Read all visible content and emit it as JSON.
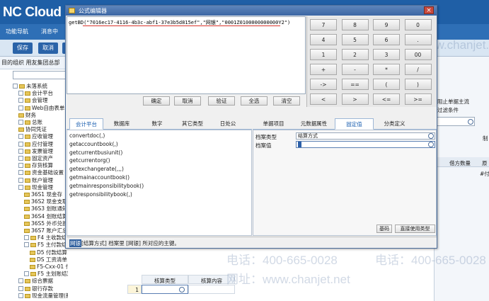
{
  "app": {
    "logo": "NC Cloud",
    "nav_tabs": [
      "功能导航",
      "消息中"
    ],
    "toolbar": [
      "保存",
      "取消",
      "增"
    ],
    "org_label": "目的组织",
    "org_value": "用友集团总部",
    "tree": [
      {
        "label": "未落系统",
        "level": 0,
        "state": "expanded"
      },
      {
        "label": "会计平台",
        "level": 1,
        "state": "collapsed"
      },
      {
        "label": "会管理",
        "level": 1,
        "state": "collapsed"
      },
      {
        "label": "Web自由表单",
        "level": 1,
        "state": "collapsed"
      },
      {
        "label": "财务",
        "level": 1,
        "state": "leaf"
      },
      {
        "label": "总账",
        "level": 1,
        "state": "collapsed"
      },
      {
        "label": "协同凭证",
        "level": 1,
        "state": "leaf"
      },
      {
        "label": "应收管理",
        "level": 1,
        "state": "collapsed"
      },
      {
        "label": "应付管理",
        "level": 1,
        "state": "collapsed"
      },
      {
        "label": "发票管理",
        "level": 1,
        "state": "collapsed"
      },
      {
        "label": "固定资产",
        "level": 1,
        "state": "collapsed"
      },
      {
        "label": "存货核算",
        "level": 1,
        "state": "collapsed"
      },
      {
        "label": "资金基础设置",
        "level": 1,
        "state": "collapsed"
      },
      {
        "label": "账户管理",
        "level": 1,
        "state": "collapsed"
      },
      {
        "label": "现金管理",
        "level": 1,
        "state": "expanded"
      },
      {
        "label": "36S1 现金存",
        "level": 2,
        "state": "leaf"
      },
      {
        "label": "36S2 现金支取",
        "level": 2,
        "state": "leaf"
      },
      {
        "label": "36S3 划账通知",
        "level": 2,
        "state": "leaf"
      },
      {
        "label": "36S4 划账结算",
        "level": 2,
        "state": "leaf"
      },
      {
        "label": "36S5 外币兑换",
        "level": 2,
        "state": "leaf"
      },
      {
        "label": "36S7 账户汇总",
        "level": 2,
        "state": "leaf"
      },
      {
        "label": "F4 主收款结",
        "level": 2,
        "state": "collapsed"
      },
      {
        "label": "F5 主付款结",
        "level": 2,
        "state": "expanded"
      },
      {
        "label": "D5 付款结算",
        "level": 3,
        "state": "leaf"
      },
      {
        "label": "DS 工资清单",
        "level": 3,
        "state": "leaf"
      },
      {
        "label": "F5-Cxx-01 付款结算dan1",
        "level": 3,
        "state": "leaf"
      },
      {
        "label": "F5 主划账结算单",
        "level": 2,
        "state": "collapsed"
      },
      {
        "label": "综合票据",
        "level": 1,
        "state": "collapsed"
      },
      {
        "label": "银行存款",
        "level": 1,
        "state": "collapsed"
      },
      {
        "label": "现金流量管理(新版)",
        "level": 1,
        "state": "collapsed"
      }
    ],
    "right_panel": {
      "line1": "阻止单据主流",
      "line2": "过滤条件",
      "label_right": "制",
      "col1": "借方数量",
      "col2": "原",
      "row1_right": "#付"
    },
    "grid": {
      "headers": [
        "核算类型",
        "核算内容"
      ],
      "row_no": "1"
    },
    "watermarks": [
      "电话：400-665-0028",
      "网址：www.chanjet.net"
    ]
  },
  "dialog": {
    "title": "公式编辑器",
    "close_glyph": "×",
    "formula": "getBD(\"7016ec17-4116-4b3c-abf1-37e3b5d815ef\",\"网银\",\"0001Z0100000000000Y2\")",
    "buttons": [
      "确定",
      "取消",
      "验证",
      "全选",
      "清空"
    ],
    "keypad": [
      [
        "7",
        "8",
        "9",
        "0"
      ],
      [
        "4",
        "5",
        "6",
        "."
      ],
      [
        "1",
        "2",
        "3",
        "00"
      ],
      [
        "+",
        "-",
        "*",
        "/"
      ],
      [
        "->",
        "==",
        "(",
        ")"
      ],
      [
        "<",
        ">",
        "<=",
        ">="
      ]
    ],
    "tabs_left": [
      "会计平台",
      "数据库",
      "数字",
      "其它类型",
      "日处公"
    ],
    "tabs_left_selected": 0,
    "tabs_right": [
      "单据项目",
      "元数据属性",
      "固定值",
      "分类定义"
    ],
    "tabs_right_selected": 2,
    "functions": [
      "convertdoc(,)",
      "getaccountbook(,)",
      "getcurrentbusiunit()",
      "getcurrentorg()",
      "getexchangerate(,,,)",
      "getmainaccountbook()",
      "getmainresponsibilitybook()",
      "getresponsibilitybook(,)"
    ],
    "panel": {
      "label_type": "档案类型",
      "value_type": "结算方式",
      "label_value": "档案值",
      "value_value": "",
      "btn_ok": "基码",
      "btn_direct": "直接使用类型"
    },
    "status_hl": "网银",
    "status_rest": "[结算方式] 档案里 [网银] 所对应的主键。"
  }
}
